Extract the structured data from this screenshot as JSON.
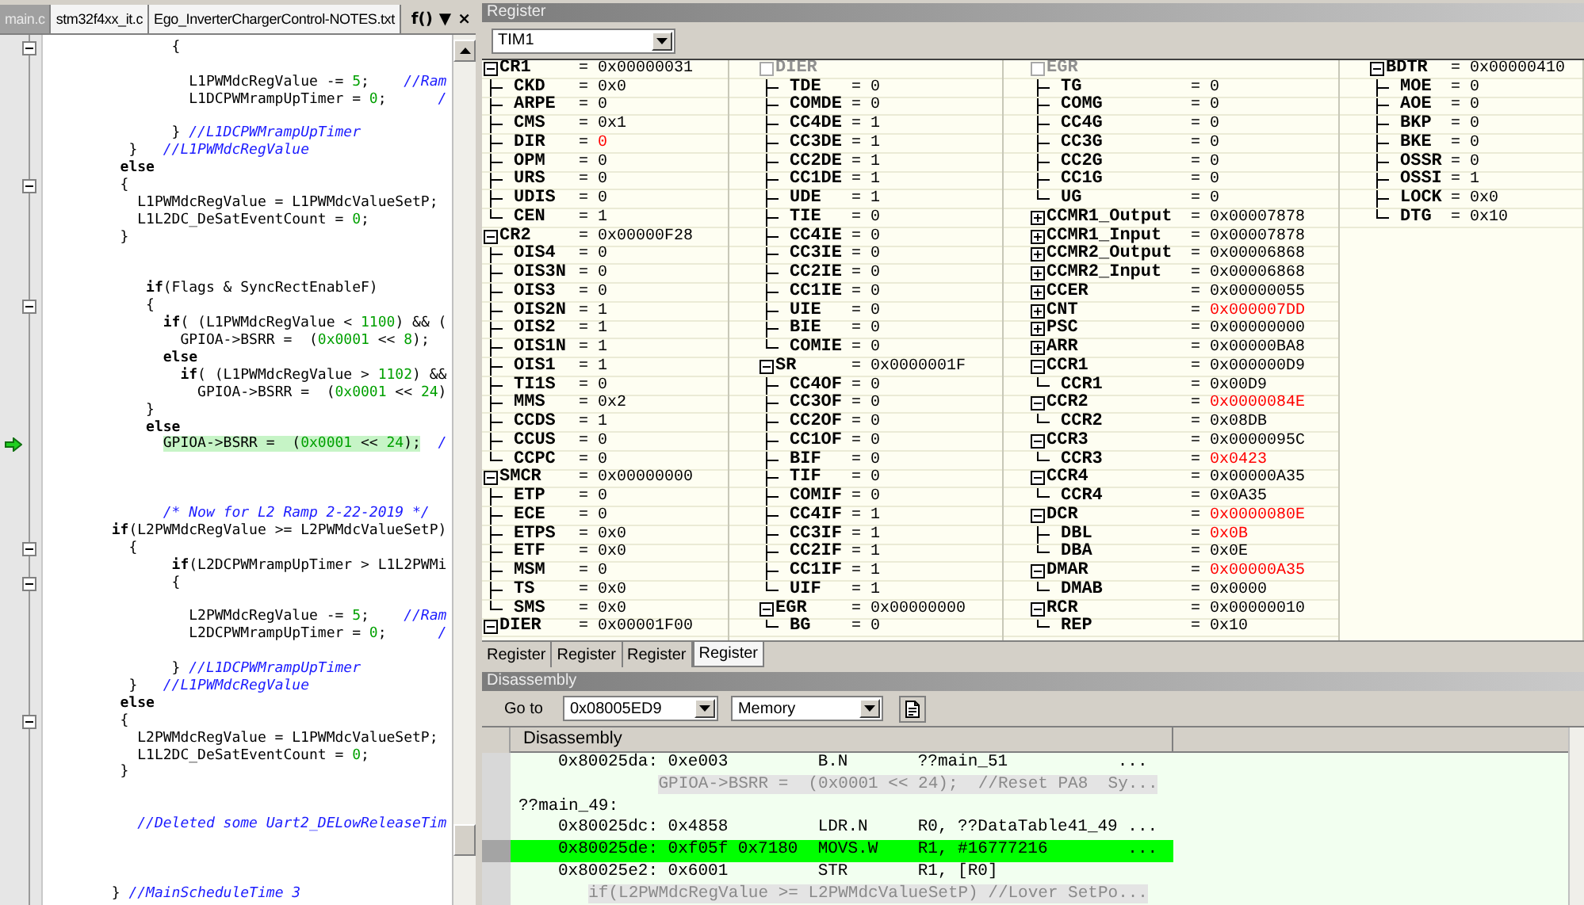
{
  "editor": {
    "tabs": [
      {
        "label": "main.c",
        "selected": true
      },
      {
        "label": "stm32f4xx_it.c",
        "selected": false
      },
      {
        "label": "Ego_InverterChargerControl-NOTES.txt",
        "selected": false
      }
    ],
    "tools": [
      "f()",
      "▼",
      "×"
    ],
    "lines": [
      {
        "fold": true,
        "current": false,
        "parts": [
          {
            "kind": "code",
            "text": "               {"
          }
        ]
      },
      {
        "fold": false,
        "current": false
      },
      {
        "fold": false,
        "current": false,
        "parts": [
          {
            "kind": "code",
            "text": "                 L1PWMdcRegValue -= "
          },
          {
            "kind": "number",
            "text": "5"
          },
          {
            "kind": "code",
            "text": ";    "
          },
          {
            "kind": "comment",
            "text": "//Ram"
          }
        ]
      },
      {
        "fold": false,
        "current": false,
        "parts": [
          {
            "kind": "code",
            "text": "                 L1DCPWMrampUpTimer = "
          },
          {
            "kind": "number",
            "text": "0"
          },
          {
            "kind": "code",
            "text": ";      "
          },
          {
            "kind": "comment",
            "text": "/"
          }
        ]
      },
      {
        "fold": false,
        "current": false
      },
      {
        "fold": false,
        "current": false,
        "parts": [
          {
            "kind": "code",
            "text": "               } "
          },
          {
            "kind": "comment",
            "text": "//L1DCPWMrampUpTimer"
          }
        ]
      },
      {
        "fold": false,
        "current": false,
        "parts": [
          {
            "kind": "code",
            "text": "          }   "
          },
          {
            "kind": "comment",
            "text": "//L1PWMdcRegValue"
          }
        ]
      },
      {
        "fold": false,
        "current": false,
        "parts": [
          {
            "kind": "keyword",
            "text": "         else"
          }
        ]
      },
      {
        "fold": true,
        "current": false,
        "parts": [
          {
            "kind": "code",
            "text": "         {"
          }
        ]
      },
      {
        "fold": false,
        "current": false,
        "parts": [
          {
            "kind": "code",
            "text": "           L1PWMdcRegValue = L1PWMdcValueSetP;"
          }
        ]
      },
      {
        "fold": false,
        "current": false,
        "parts": [
          {
            "kind": "code",
            "text": "           L1L2DC_DeSatEventCount = "
          },
          {
            "kind": "number",
            "text": "0"
          },
          {
            "kind": "code",
            "text": ";"
          }
        ]
      },
      {
        "fold": false,
        "current": false,
        "parts": [
          {
            "kind": "code",
            "text": "         }"
          }
        ]
      },
      {
        "fold": false,
        "current": false
      },
      {
        "fold": false,
        "current": false
      },
      {
        "fold": false,
        "current": false,
        "parts": [
          {
            "kind": "keyword",
            "text": "            if"
          },
          {
            "kind": "code",
            "text": "(Flags & SyncRectEnableF)"
          }
        ]
      },
      {
        "fold": true,
        "current": false,
        "parts": [
          {
            "kind": "code",
            "text": "            {"
          }
        ]
      },
      {
        "fold": false,
        "current": false,
        "parts": [
          {
            "kind": "keyword",
            "text": "              if"
          },
          {
            "kind": "code",
            "text": "( (L1PWMdcRegValue < "
          },
          {
            "kind": "number",
            "text": "1100"
          },
          {
            "kind": "code",
            "text": ") && ("
          }
        ]
      },
      {
        "fold": false,
        "current": false,
        "parts": [
          {
            "kind": "code",
            "text": "                GPIOA->BSRR =  ("
          },
          {
            "kind": "number",
            "text": "0x0001"
          },
          {
            "kind": "code",
            "text": " << "
          },
          {
            "kind": "number",
            "text": "8"
          },
          {
            "kind": "code",
            "text": ");"
          }
        ]
      },
      {
        "fold": false,
        "current": false,
        "parts": [
          {
            "kind": "keyword",
            "text": "              else"
          }
        ]
      },
      {
        "fold": false,
        "current": false,
        "parts": [
          {
            "kind": "keyword",
            "text": "                if"
          },
          {
            "kind": "code",
            "text": "( (L1PWMdcRegValue > "
          },
          {
            "kind": "number",
            "text": "1102"
          },
          {
            "kind": "code",
            "text": ") &&"
          }
        ]
      },
      {
        "fold": false,
        "current": false,
        "parts": [
          {
            "kind": "code",
            "text": "                  GPIOA->BSRR =  ("
          },
          {
            "kind": "number",
            "text": "0x0001"
          },
          {
            "kind": "code",
            "text": " << "
          },
          {
            "kind": "number",
            "text": "24"
          },
          {
            "kind": "code",
            "text": ")"
          }
        ]
      },
      {
        "fold": false,
        "current": false,
        "parts": [
          {
            "kind": "code",
            "text": "            }"
          }
        ]
      },
      {
        "fold": false,
        "current": false,
        "parts": [
          {
            "kind": "keyword",
            "text": "            else"
          }
        ]
      },
      {
        "fold": false,
        "current": true,
        "parts": [
          {
            "kind": "code",
            "text": "              GPIOA->BSRR =  ("
          },
          {
            "kind": "number",
            "text": "0x0001"
          },
          {
            "kind": "code",
            "text": " << "
          },
          {
            "kind": "number",
            "text": "24"
          },
          {
            "kind": "code",
            "text": ");"
          },
          {
            "kind": "comment",
            "text": "  /"
          }
        ]
      },
      {
        "fold": false,
        "current": false
      },
      {
        "fold": false,
        "current": false
      },
      {
        "fold": false,
        "current": false
      },
      {
        "fold": false,
        "current": false,
        "parts": [
          {
            "kind": "comment",
            "text": "              /* Now for L2 Ramp 2-22-2019 */"
          }
        ]
      },
      {
        "fold": false,
        "current": false,
        "parts": [
          {
            "kind": "keyword",
            "text": "        if"
          },
          {
            "kind": "code",
            "text": "(L2PWMdcRegValue >= L2PWMdcValueSetP)"
          }
        ]
      },
      {
        "fold": true,
        "current": false,
        "parts": [
          {
            "kind": "code",
            "text": "          {"
          }
        ]
      },
      {
        "fold": false,
        "current": false,
        "parts": [
          {
            "kind": "keyword",
            "text": "               if"
          },
          {
            "kind": "code",
            "text": "(L2DCPWMrampUpTimer > L1L2PWMi"
          }
        ]
      },
      {
        "fold": true,
        "current": false,
        "parts": [
          {
            "kind": "code",
            "text": "               {"
          }
        ]
      },
      {
        "fold": false,
        "current": false
      },
      {
        "fold": false,
        "current": false,
        "parts": [
          {
            "kind": "code",
            "text": "                 L2PWMdcRegValue -= "
          },
          {
            "kind": "number",
            "text": "5"
          },
          {
            "kind": "code",
            "text": ";    "
          },
          {
            "kind": "comment",
            "text": "//Ram"
          }
        ]
      },
      {
        "fold": false,
        "current": false,
        "parts": [
          {
            "kind": "code",
            "text": "                 L2DCPWMrampUpTimer = "
          },
          {
            "kind": "number",
            "text": "0"
          },
          {
            "kind": "code",
            "text": ";      "
          },
          {
            "kind": "comment",
            "text": "/"
          }
        ]
      },
      {
        "fold": false,
        "current": false
      },
      {
        "fold": false,
        "current": false,
        "parts": [
          {
            "kind": "code",
            "text": "               } "
          },
          {
            "kind": "comment",
            "text": "//L1DCPWMrampUpTimer"
          }
        ]
      },
      {
        "fold": false,
        "current": false,
        "parts": [
          {
            "kind": "code",
            "text": "          }   "
          },
          {
            "kind": "comment",
            "text": "//L1PWMdcRegValue"
          }
        ]
      },
      {
        "fold": false,
        "current": false,
        "parts": [
          {
            "kind": "keyword",
            "text": "         else"
          }
        ]
      },
      {
        "fold": true,
        "current": false,
        "parts": [
          {
            "kind": "code",
            "text": "         {"
          }
        ]
      },
      {
        "fold": false,
        "current": false,
        "parts": [
          {
            "kind": "code",
            "text": "           L2PWMdcRegValue = L1PWMdcValueSetP;"
          }
        ]
      },
      {
        "fold": false,
        "current": false,
        "parts": [
          {
            "kind": "code",
            "text": "           L1L2DC_DeSatEventCount = "
          },
          {
            "kind": "number",
            "text": "0"
          },
          {
            "kind": "code",
            "text": ";"
          }
        ]
      },
      {
        "fold": false,
        "current": false,
        "parts": [
          {
            "kind": "code",
            "text": "         }"
          }
        ]
      },
      {
        "fold": false,
        "current": false
      },
      {
        "fold": false,
        "current": false
      },
      {
        "fold": false,
        "current": false,
        "parts": [
          {
            "kind": "comment",
            "text": "           //Deleted some Uart2_DELowReleaseTim"
          }
        ]
      },
      {
        "fold": false,
        "current": false
      },
      {
        "fold": false,
        "current": false
      },
      {
        "fold": false,
        "current": false
      },
      {
        "fold": false,
        "current": false,
        "parts": [
          {
            "kind": "code",
            "text": "        } "
          },
          {
            "kind": "comment",
            "text": "//MainScheduleTime 3"
          }
        ]
      }
    ]
  },
  "register": {
    "title": "Register",
    "peripheral": "TIM1",
    "columns": [
      {
        "registers": [
          {
            "name": "CR1",
            "value": "= 0x00000031",
            "continued": false,
            "expanded": true,
            "changed": false,
            "children": [
              {
                "name": "CKD",
                "value": "= 0x0",
                "changed": false
              },
              {
                "name": "ARPE",
                "value": "= 0",
                "changed": false
              },
              {
                "name": "CMS",
                "value": "= 0x1",
                "changed": false
              },
              {
                "name": "DIR",
                "value": "= 0",
                "changed": true
              },
              {
                "name": "OPM",
                "value": "= 0",
                "changed": false
              },
              {
                "name": "URS",
                "value": "= 0",
                "changed": false
              },
              {
                "name": "UDIS",
                "value": "= 0",
                "changed": false
              },
              {
                "name": "CEN",
                "value": "= 1",
                "changed": false
              }
            ]
          },
          {
            "name": "CR2",
            "value": "= 0x00000F28",
            "continued": false,
            "expanded": true,
            "changed": false,
            "children": [
              {
                "name": "OIS4",
                "value": "= 0",
                "changed": false
              },
              {
                "name": "OIS3N",
                "value": "= 0",
                "changed": false
              },
              {
                "name": "OIS3",
                "value": "= 0",
                "changed": false
              },
              {
                "name": "OIS2N",
                "value": "= 1",
                "changed": false
              },
              {
                "name": "OIS2",
                "value": "= 1",
                "changed": false
              },
              {
                "name": "OIS1N",
                "value": "= 1",
                "changed": false
              },
              {
                "name": "OIS1",
                "value": "= 1",
                "changed": false
              },
              {
                "name": "TI1S",
                "value": "= 0",
                "changed": false
              },
              {
                "name": "MMS",
                "value": "= 0x2",
                "changed": false
              },
              {
                "name": "CCDS",
                "value": "= 1",
                "changed": false
              },
              {
                "name": "CCUS",
                "value": "= 0",
                "changed": false
              },
              {
                "name": "CCPC",
                "value": "= 0",
                "changed": false
              }
            ]
          },
          {
            "name": "SMCR",
            "value": "= 0x00000000",
            "continued": false,
            "expanded": true,
            "changed": false,
            "children": [
              {
                "name": "ETP",
                "value": "= 0",
                "changed": false
              },
              {
                "name": "ECE",
                "value": "= 0",
                "changed": false
              },
              {
                "name": "ETPS",
                "value": "= 0x0",
                "changed": false
              },
              {
                "name": "ETF",
                "value": "= 0x0",
                "changed": false
              },
              {
                "name": "MSM",
                "value": "= 0",
                "changed": false
              },
              {
                "name": "TS",
                "value": "= 0x0",
                "changed": false
              },
              {
                "name": "SMS",
                "value": "= 0x0",
                "changed": false
              }
            ]
          },
          {
            "name": "DIER",
            "value": "= 0x00001F00",
            "continued": false,
            "expanded": true,
            "changed": false
          }
        ]
      },
      {
        "registers": [
          {
            "name": "DIER",
            "continued": true,
            "children": [
              {
                "name": "TDE",
                "value": "= 0",
                "changed": false
              },
              {
                "name": "COMDE",
                "value": "= 0",
                "changed": false
              },
              {
                "name": "CC4DE",
                "value": "= 1",
                "changed": false
              },
              {
                "name": "CC3DE",
                "value": "= 1",
                "changed": false
              },
              {
                "name": "CC2DE",
                "value": "= 1",
                "changed": false
              },
              {
                "name": "CC1DE",
                "value": "= 1",
                "changed": false
              },
              {
                "name": "UDE",
                "value": "= 1",
                "changed": false
              },
              {
                "name": "TIE",
                "value": "= 0",
                "changed": false
              },
              {
                "name": "CC4IE",
                "value": "= 0",
                "changed": false
              },
              {
                "name": "CC3IE",
                "value": "= 0",
                "changed": false
              },
              {
                "name": "CC2IE",
                "value": "= 0",
                "changed": false
              },
              {
                "name": "CC1IE",
                "value": "= 0",
                "changed": false
              },
              {
                "name": "UIE",
                "value": "= 0",
                "changed": false
              },
              {
                "name": "BIE",
                "value": "= 0",
                "changed": false
              },
              {
                "name": "COMIE",
                "value": "= 0",
                "changed": false
              }
            ]
          },
          {
            "name": "SR",
            "value": "= 0x0000001F",
            "continued": false,
            "expanded": true,
            "changed": false,
            "children": [
              {
                "name": "CC4OF",
                "value": "= 0",
                "changed": false
              },
              {
                "name": "CC3OF",
                "value": "= 0",
                "changed": false
              },
              {
                "name": "CC2OF",
                "value": "= 0",
                "changed": false
              },
              {
                "name": "CC1OF",
                "value": "= 0",
                "changed": false
              },
              {
                "name": "BIF",
                "value": "= 0",
                "changed": false
              },
              {
                "name": "TIF",
                "value": "= 0",
                "changed": false
              },
              {
                "name": "COMIF",
                "value": "= 0",
                "changed": false
              },
              {
                "name": "CC4IF",
                "value": "= 1",
                "changed": false
              },
              {
                "name": "CC3IF",
                "value": "= 1",
                "changed": false
              },
              {
                "name": "CC2IF",
                "value": "= 1",
                "changed": false
              },
              {
                "name": "CC1IF",
                "value": "= 1",
                "changed": false
              },
              {
                "name": "UIF",
                "value": "= 1",
                "changed": false
              }
            ]
          },
          {
            "name": "EGR",
            "value": "= 0x00000000",
            "continued": false,
            "expanded": true,
            "changed": false,
            "children": [
              {
                "name": "BG",
                "value": "= 0",
                "changed": false
              }
            ]
          }
        ]
      },
      {
        "registers": [
          {
            "name": "EGR",
            "continued": true,
            "children": [
              {
                "name": "TG",
                "value": "= 0",
                "changed": false
              },
              {
                "name": "COMG",
                "value": "= 0",
                "changed": false
              },
              {
                "name": "CC4G",
                "value": "= 0",
                "changed": false
              },
              {
                "name": "CC3G",
                "value": "= 0",
                "changed": false
              },
              {
                "name": "CC2G",
                "value": "= 0",
                "changed": false
              },
              {
                "name": "CC1G",
                "value": "= 0",
                "changed": false
              },
              {
                "name": "UG",
                "value": "= 0",
                "changed": false
              }
            ]
          },
          {
            "name": "CCMR1_Output",
            "value": "= 0x00007878",
            "continued": false,
            "expanded": false,
            "changed": false
          },
          {
            "name": "CCMR1_Input",
            "value": "= 0x00007878",
            "continued": false,
            "expanded": false,
            "changed": false
          },
          {
            "name": "CCMR2_Output",
            "value": "= 0x00006868",
            "continued": false,
            "expanded": false,
            "changed": false
          },
          {
            "name": "CCMR2_Input",
            "value": "= 0x00006868",
            "continued": false,
            "expanded": false,
            "changed": false
          },
          {
            "name": "CCER",
            "value": "= 0x00000055",
            "continued": false,
            "expanded": false,
            "changed": false
          },
          {
            "name": "CNT",
            "value": "= 0x000007DD",
            "continued": false,
            "expanded": false,
            "changed": true
          },
          {
            "name": "PSC",
            "value": "= 0x00000000",
            "continued": false,
            "expanded": false,
            "changed": false
          },
          {
            "name": "ARR",
            "value": "= 0x00000BA8",
            "continued": false,
            "expanded": false,
            "changed": false
          },
          {
            "name": "CCR1",
            "value": "= 0x000000D9",
            "continued": false,
            "expanded": true,
            "changed": false,
            "children": [
              {
                "name": "CCR1",
                "value": "= 0x00D9",
                "changed": false
              }
            ]
          },
          {
            "name": "CCR2",
            "value": "= 0x0000084E",
            "continued": false,
            "expanded": true,
            "changed": true,
            "children": [
              {
                "name": "CCR2",
                "value": "= 0x08DB",
                "changed": false
              }
            ]
          },
          {
            "name": "CCR3",
            "value": "= 0x0000095C",
            "continued": false,
            "expanded": true,
            "changed": false,
            "children": [
              {
                "name": "CCR3",
                "value": "= 0x0423",
                "changed": true
              }
            ]
          },
          {
            "name": "CCR4",
            "value": "= 0x00000A35",
            "continued": false,
            "expanded": true,
            "changed": false,
            "children": [
              {
                "name": "CCR4",
                "value": "= 0x0A35",
                "changed": false
              }
            ]
          },
          {
            "name": "DCR",
            "value": "= 0x0000080E",
            "continued": false,
            "expanded": true,
            "changed": true,
            "children": [
              {
                "name": "DBL",
                "value": "= 0x0B",
                "changed": true
              },
              {
                "name": "DBA",
                "value": "= 0x0E",
                "changed": false
              }
            ]
          },
          {
            "name": "DMAR",
            "value": "= 0x00000A35",
            "continued": false,
            "expanded": true,
            "changed": true,
            "children": [
              {
                "name": "DMAB",
                "value": "= 0x0000",
                "changed": false
              }
            ]
          },
          {
            "name": "RCR",
            "value": "= 0x00000010",
            "continued": false,
            "expanded": true,
            "changed": false,
            "children": [
              {
                "name": "REP",
                "value": "= 0x10",
                "changed": false
              }
            ]
          }
        ]
      },
      {
        "registers": [
          {
            "name": "BDTR",
            "value": "= 0x00000410",
            "continued": false,
            "expanded": true,
            "changed": false,
            "children": [
              {
                "name": "MOE",
                "value": "= 0",
                "changed": false
              },
              {
                "name": "AOE",
                "value": "= 0",
                "changed": false
              },
              {
                "name": "BKP",
                "value": "= 0",
                "changed": false
              },
              {
                "name": "BKE",
                "value": "= 0",
                "changed": false
              },
              {
                "name": "OSSR",
                "value": "= 0",
                "changed": false
              },
              {
                "name": "OSSI",
                "value": "= 1",
                "changed": false
              },
              {
                "name": "LOCK",
                "value": "= 0x0",
                "changed": false
              },
              {
                "name": "DTG",
                "value": "= 0x10",
                "changed": false
              }
            ]
          }
        ]
      }
    ],
    "tabs": [
      {
        "label": "Register",
        "selected": false
      },
      {
        "label": "Register",
        "selected": false
      },
      {
        "label": "Register",
        "selected": false
      },
      {
        "label": "Register",
        "selected": true
      }
    ]
  },
  "disassembly": {
    "title": "Disassembly",
    "goto_label": "Go to",
    "address": "0x08005ED9",
    "view": "Memory",
    "header": "Disassembly",
    "rows": [
      {
        "kind": "instruction",
        "current": false,
        "text": "0x80025da: 0xe003         B.N       ??main_51           ..."
      },
      {
        "kind": "source",
        "current": false,
        "text": "              GPIOA->BSRR =  (0x0001 << 24);  //Reset PA8  Sy..."
      },
      {
        "kind": "label",
        "current": false,
        "text": "??main_49:"
      },
      {
        "kind": "instruction",
        "current": false,
        "text": "0x80025dc: 0x4858         LDR.N     R0, ??DataTable41_49 ..."
      },
      {
        "kind": "instruction",
        "current": true,
        "text": "0x80025de: 0xf05f 0x7180  MOVS.W    R1, #16777216        ..."
      },
      {
        "kind": "instruction",
        "current": false,
        "text": "0x80025e2: 0x6001         STR       R1, [R0]"
      },
      {
        "kind": "source",
        "current": false,
        "text": "       if(L2PWMdcRegValue >= L2PWMdcValueSetP) //Lover SetPo..."
      }
    ]
  }
}
